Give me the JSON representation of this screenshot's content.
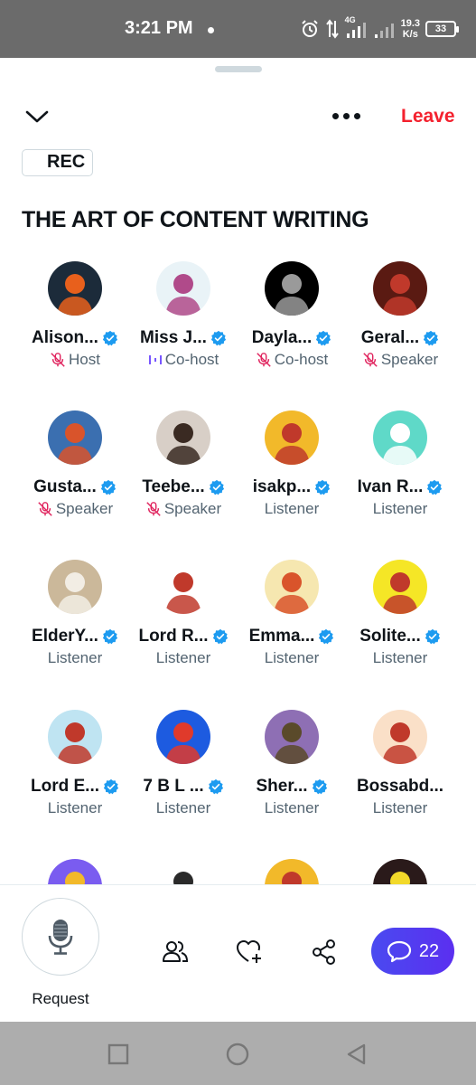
{
  "status_bar": {
    "time": "3:21 PM",
    "network": "4G",
    "speed_value": "19.3",
    "speed_unit": "K/s",
    "battery": "33"
  },
  "header": {
    "collapse_icon": "chevron-down-icon",
    "more_icon": "more-horizontal-icon",
    "leave_label": "Leave",
    "leave_color": "#f4212e"
  },
  "space": {
    "rec_label": "REC",
    "title": "THE ART OF CONTENT WRITING"
  },
  "participants": [
    {
      "name": "Alison...",
      "verified": true,
      "role": "Host",
      "mic_muted": true,
      "avatar_bg": "#1c2b3a",
      "avatar_accent": "#e8601c"
    },
    {
      "name": "Miss J...",
      "verified": true,
      "role": "Co-host",
      "speaking": true,
      "avatar_bg": "#e9f3f7",
      "avatar_accent": "#b04a8a"
    },
    {
      "name": "Dayla...",
      "verified": true,
      "role": "Co-host",
      "mic_muted": true,
      "avatar_bg": "#000000",
      "avatar_accent": "#9a9a9a"
    },
    {
      "name": "Geral...",
      "verified": true,
      "role": "Speaker",
      "mic_muted": true,
      "avatar_bg": "#5a1a12",
      "avatar_accent": "#c0392b"
    },
    {
      "name": "Gusta...",
      "verified": true,
      "role": "Speaker",
      "mic_muted": true,
      "avatar_bg": "#3b6fb0",
      "avatar_accent": "#d9542b"
    },
    {
      "name": "Teebe...",
      "verified": true,
      "role": "Speaker",
      "mic_muted": true,
      "avatar_bg": "#d8cfc7",
      "avatar_accent": "#3a2a22"
    },
    {
      "name": "isakp...",
      "verified": true,
      "role": "Listener",
      "avatar_bg": "#f2b92a",
      "avatar_accent": "#c0392b"
    },
    {
      "name": "Ivan R...",
      "verified": true,
      "role": "Listener",
      "avatar_bg": "#5fd9c8",
      "avatar_accent": "#ffffff"
    },
    {
      "name": "ElderY...",
      "verified": true,
      "role": "Listener",
      "avatar_bg": "#cbb89a",
      "avatar_accent": "#f2ede4"
    },
    {
      "name": "Lord R...",
      "verified": true,
      "role": "Listener",
      "avatar_bg": "#ffffff",
      "avatar_accent": "#c0392b"
    },
    {
      "name": "Emma...",
      "verified": true,
      "role": "Listener",
      "avatar_bg": "#f6e7b0",
      "avatar_accent": "#d9542b"
    },
    {
      "name": "Solite...",
      "verified": true,
      "role": "Listener",
      "avatar_bg": "#f5e626",
      "avatar_accent": "#c0392b"
    },
    {
      "name": "Lord E...",
      "verified": true,
      "role": "Listener",
      "avatar_bg": "#bfe4f2",
      "avatar_accent": "#c0392b"
    },
    {
      "name": "7 B L ...",
      "verified": true,
      "role": "Listener",
      "avatar_bg": "#1d5be0",
      "avatar_accent": "#e03a2b"
    },
    {
      "name": "Sher...",
      "verified": true,
      "role": "Listener",
      "avatar_bg": "#8e6fb4",
      "avatar_accent": "#5a4a2a"
    },
    {
      "name": "Bossabd...",
      "verified": false,
      "role": "Listener",
      "avatar_bg": "#fae0c8",
      "avatar_accent": "#c0392b"
    },
    {
      "name": "",
      "verified": false,
      "role": "",
      "avatar_bg": "#7a5cf0",
      "avatar_accent": "#f2b92a"
    },
    {
      "name": "",
      "verified": false,
      "role": "",
      "avatar_bg": "#ffffff",
      "avatar_accent": "#2a2a2a"
    },
    {
      "name": "",
      "verified": false,
      "role": "",
      "avatar_bg": "#f2b92a",
      "avatar_accent": "#c0392b"
    },
    {
      "name": "",
      "verified": false,
      "role": "",
      "avatar_bg": "#2a1a1a",
      "avatar_accent": "#f2d92a"
    }
  ],
  "bottom_bar": {
    "request_label": "Request",
    "request_icon": "microphone-icon",
    "people_icon": "people-icon",
    "heart_icon": "heart-add-icon",
    "share_icon": "share-icon",
    "comments_icon": "comment-icon",
    "comments_count": "22",
    "comments_color": "#4a3af0"
  },
  "nav_bar": {
    "recents_icon": "square-icon",
    "home_icon": "circle-icon",
    "back_icon": "triangle-back-icon"
  },
  "colors": {
    "verified_blue": "#1d9bf0",
    "mute_pink": "#e0245e",
    "muted_text": "#536471"
  }
}
